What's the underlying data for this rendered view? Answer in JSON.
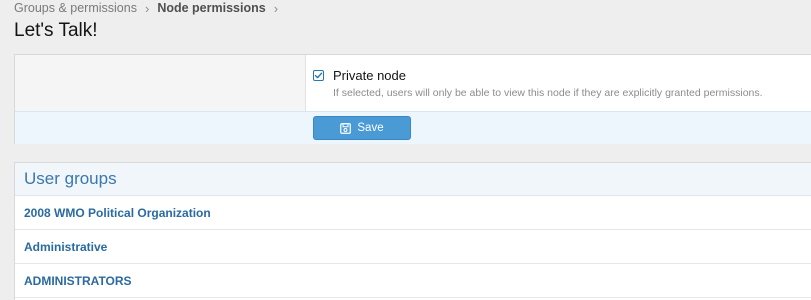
{
  "breadcrumb": {
    "items": [
      "Groups & permissions",
      "Node permissions"
    ],
    "separator": "›"
  },
  "page": {
    "title": "Let's Talk!"
  },
  "options": {
    "private_node": {
      "label": "Private node",
      "checked": true,
      "hint": "If selected, users will only be able to view this node if they are explicitly granted permissions."
    }
  },
  "actions": {
    "save_label": "Save",
    "save_icon": "save-icon"
  },
  "user_groups": {
    "heading": "User groups",
    "items": [
      {
        "label": "2008 WMO Political Organization"
      },
      {
        "label": "Administrative"
      },
      {
        "label": "ADMINISTRATORS"
      }
    ]
  },
  "colors": {
    "accent": "#2577b1",
    "button": "#4a9ad6",
    "link": "#2a6aa1",
    "header_text": "#3a78ad"
  }
}
